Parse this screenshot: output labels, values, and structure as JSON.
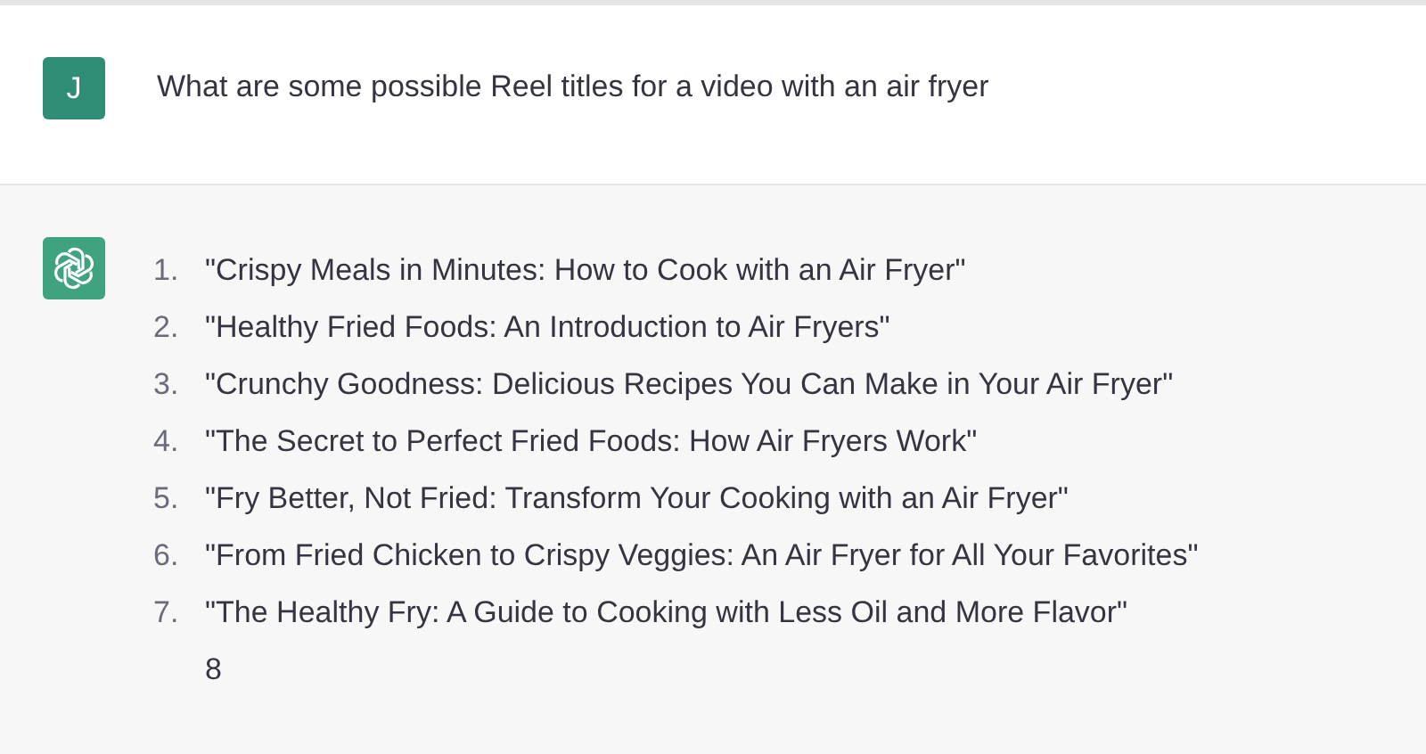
{
  "user_message": {
    "avatar": "J",
    "text": "What are some possible Reel titles for a video with an air fryer"
  },
  "assistant_message": {
    "items": [
      {
        "number": "1.",
        "text": "\"Crispy Meals in Minutes: How to Cook with an Air Fryer\""
      },
      {
        "number": "2.",
        "text": "\"Healthy Fried Foods: An Introduction to Air Fryers\""
      },
      {
        "number": "3.",
        "text": "\"Crunchy Goodness: Delicious Recipes You Can Make in Your Air Fryer\""
      },
      {
        "number": "4.",
        "text": "\"The Secret to Perfect Fried Foods: How Air Fryers Work\""
      },
      {
        "number": "5.",
        "text": "\"Fry Better, Not Fried: Transform Your Cooking with an Air Fryer\""
      },
      {
        "number": "6.",
        "text": "\"From Fried Chicken to Crispy Veggies: An Air Fryer for All Your Favorites\""
      },
      {
        "number": "7.",
        "text": "\"The Healthy Fry: A Guide to Cooking with Less Oil and More Flavor\""
      }
    ],
    "trailing_text": "8"
  }
}
